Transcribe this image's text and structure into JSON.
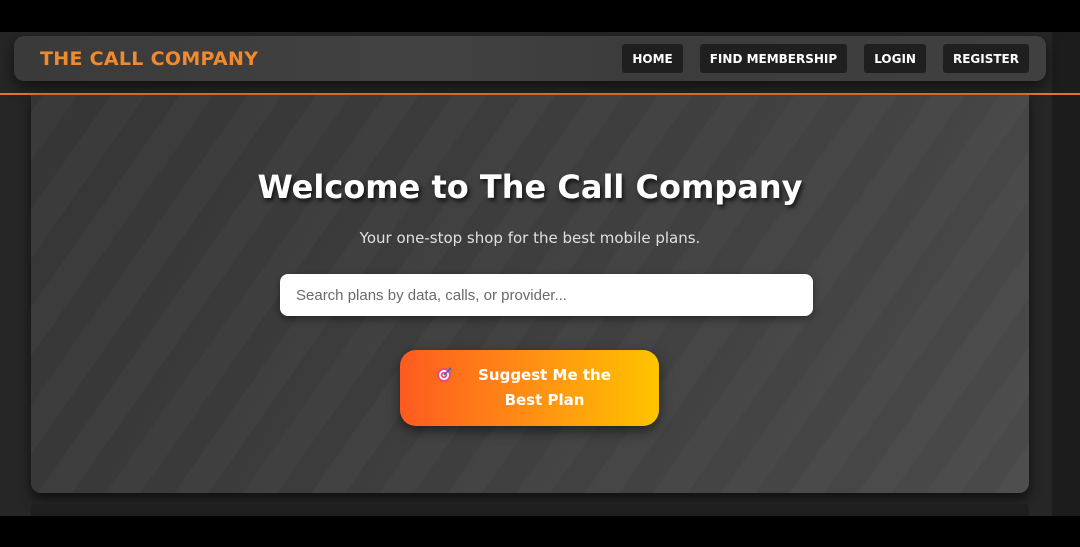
{
  "brand": "THE CALL COMPANY",
  "nav": {
    "items": [
      {
        "label": "HOME"
      },
      {
        "label": "FIND MEMBERSHIP"
      },
      {
        "label": "LOGIN"
      },
      {
        "label": "REGISTER"
      }
    ]
  },
  "hero": {
    "title": "Welcome to The Call Company",
    "subtitle": "Your one-stop shop for the best mobile plans.",
    "search_placeholder": "Search plans by data, calls, or provider...",
    "suggest_label": "Suggest Me the Best Plan",
    "suggest_icon": "target-icon"
  },
  "colors": {
    "brand": "#f08a2c",
    "accent_line": "#e8702a",
    "button_gradient_start": "#ff5a1f",
    "button_gradient_end": "#ffc400"
  }
}
